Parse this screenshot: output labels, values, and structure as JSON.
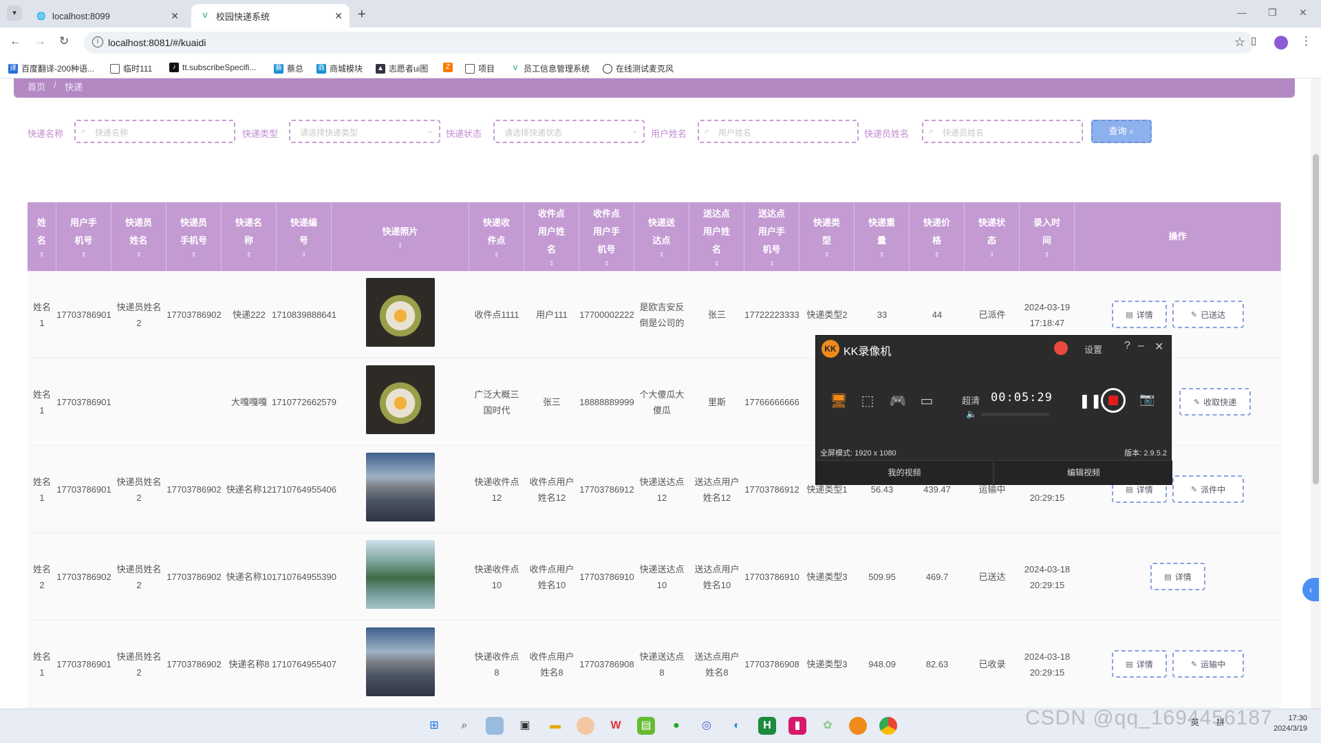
{
  "browser": {
    "tabs": [
      {
        "title": "localhost:8099",
        "active": false
      },
      {
        "title": "校园快递系统",
        "active": true
      }
    ],
    "url": "localhost:8081/#/kuaidi",
    "bookmarks": [
      "百度翻译-200种语...",
      "临时111",
      "tt.subscribeSpecifi...",
      "蔡总",
      "商城模块",
      "志愿者ui图",
      "项目",
      "员工信息管理系统",
      "在线测试麦克风"
    ]
  },
  "breadcrumb": {
    "home": "首页",
    "sep": "/",
    "current": "快递"
  },
  "search": {
    "fields": [
      {
        "label": "快递名称",
        "placeholder": "快递名称"
      },
      {
        "label": "快递类型",
        "placeholder": "请选择快递类型"
      },
      {
        "label": "快递状态",
        "placeholder": "请选择快递状态"
      },
      {
        "label": "用户姓名",
        "placeholder": "用户姓名"
      },
      {
        "label": "快递员姓名",
        "placeholder": "快递员姓名"
      }
    ],
    "button": "查询"
  },
  "table": {
    "headers": [
      "姓名",
      "用户手机号",
      "快递员姓名",
      "快递员手机号",
      "快递名称",
      "快递编号",
      "快递照片",
      "快递收件点",
      "收件点用户姓名",
      "收件点用户手机号",
      "快递送达点",
      "送达点用户姓名",
      "送达点用户手机号",
      "快递类型",
      "快递重量",
      "快递价格",
      "快递状态",
      "录入时间",
      "操作"
    ],
    "rows": [
      {
        "name": "姓名1",
        "phone": "17703786901",
        "courier": "快递员姓名2",
        "courier_phone": "17703786902",
        "kd_name": "快递222",
        "kd_no": "1710839888641",
        "photo": "flowers",
        "pickup": "收件点1111",
        "pickup_user": "用户111",
        "pickup_phone": "17700002222",
        "dest": "是欧吉安反倒是公司的",
        "dest_user": "张三",
        "dest_phone": "17722223333",
        "type": "快递类型2",
        "weight": "33",
        "price": "44",
        "status": "已派件",
        "time": "2024-03-19 17:18:47",
        "actions": [
          "详情",
          "已送达"
        ]
      },
      {
        "name": "姓名1",
        "phone": "17703786901",
        "courier": "",
        "courier_phone": "",
        "kd_name": "大嘎嘎嘎",
        "kd_no": "1710772662579",
        "photo": "flowers",
        "pickup": "广泛大概三国时代",
        "pickup_user": "张三",
        "pickup_phone": "18888889999",
        "dest": "个大傻瓜大傻瓜",
        "dest_user": "里斯",
        "dest_phone": "17766666666",
        "type": "",
        "weight": "",
        "price": "",
        "status": "",
        "time": "",
        "actions": [
          "收取快递"
        ]
      },
      {
        "name": "姓名1",
        "phone": "17703786901",
        "courier": "快递员姓名2",
        "courier_phone": "17703786902",
        "kd_name": "快递名称12",
        "kd_no": "1710764955406",
        "photo": "city",
        "pickup": "快递收件点12",
        "pickup_user": "收件点用户姓名12",
        "pickup_phone": "17703786912",
        "dest": "快递送达点12",
        "dest_user": "送达点用户姓名12",
        "dest_phone": "17703786912",
        "type": "快递类型1",
        "weight": "56.43",
        "price": "439.47",
        "status": "运输中",
        "time": "2024-03-18 20:29:15",
        "actions": [
          "详情",
          "派件中"
        ]
      },
      {
        "name": "姓名2",
        "phone": "17703786902",
        "courier": "快递员姓名2",
        "courier_phone": "17703786902",
        "kd_name": "快递名称10",
        "kd_no": "1710764955390",
        "photo": "lake",
        "pickup": "快递收件点10",
        "pickup_user": "收件点用户姓名10",
        "pickup_phone": "17703786910",
        "dest": "快递送达点10",
        "dest_user": "送达点用户姓名10",
        "dest_phone": "17703786910",
        "type": "快递类型3",
        "weight": "509.95",
        "price": "469.7",
        "status": "已送达",
        "time": "2024-03-18 20:29:15",
        "actions": [
          "详情"
        ]
      },
      {
        "name": "姓名1",
        "phone": "17703786901",
        "courier": "快递员姓名2",
        "courier_phone": "17703786902",
        "kd_name": "快递名称8",
        "kd_no": "1710764955407",
        "photo": "city",
        "pickup": "快递收件点8",
        "pickup_user": "收件点用户姓名8",
        "pickup_phone": "17703786908",
        "dest": "快递送达点8",
        "dest_user": "送达点用户姓名8",
        "dest_phone": "17703786908",
        "type": "快递类型3",
        "weight": "948.09",
        "price": "82.63",
        "status": "已收录",
        "time": "2024-03-18 20:29:15",
        "actions": [
          "详情",
          "运输中"
        ]
      }
    ]
  },
  "recorder": {
    "title": "KK录像机",
    "settings": "设置",
    "quality": "超清",
    "timer": "00:05:29",
    "mode_label": "全屏模式:",
    "resolution": "1920 x 1080",
    "version": "版本: 2.9.5.2",
    "my_videos": "我的视频",
    "edit_video": "编辑视频"
  },
  "taskbar": {
    "ime": "英",
    "ime2": "拼",
    "time": "17:30",
    "date": "2024/3/19"
  },
  "watermark": "CSDN @qq_1694456187"
}
